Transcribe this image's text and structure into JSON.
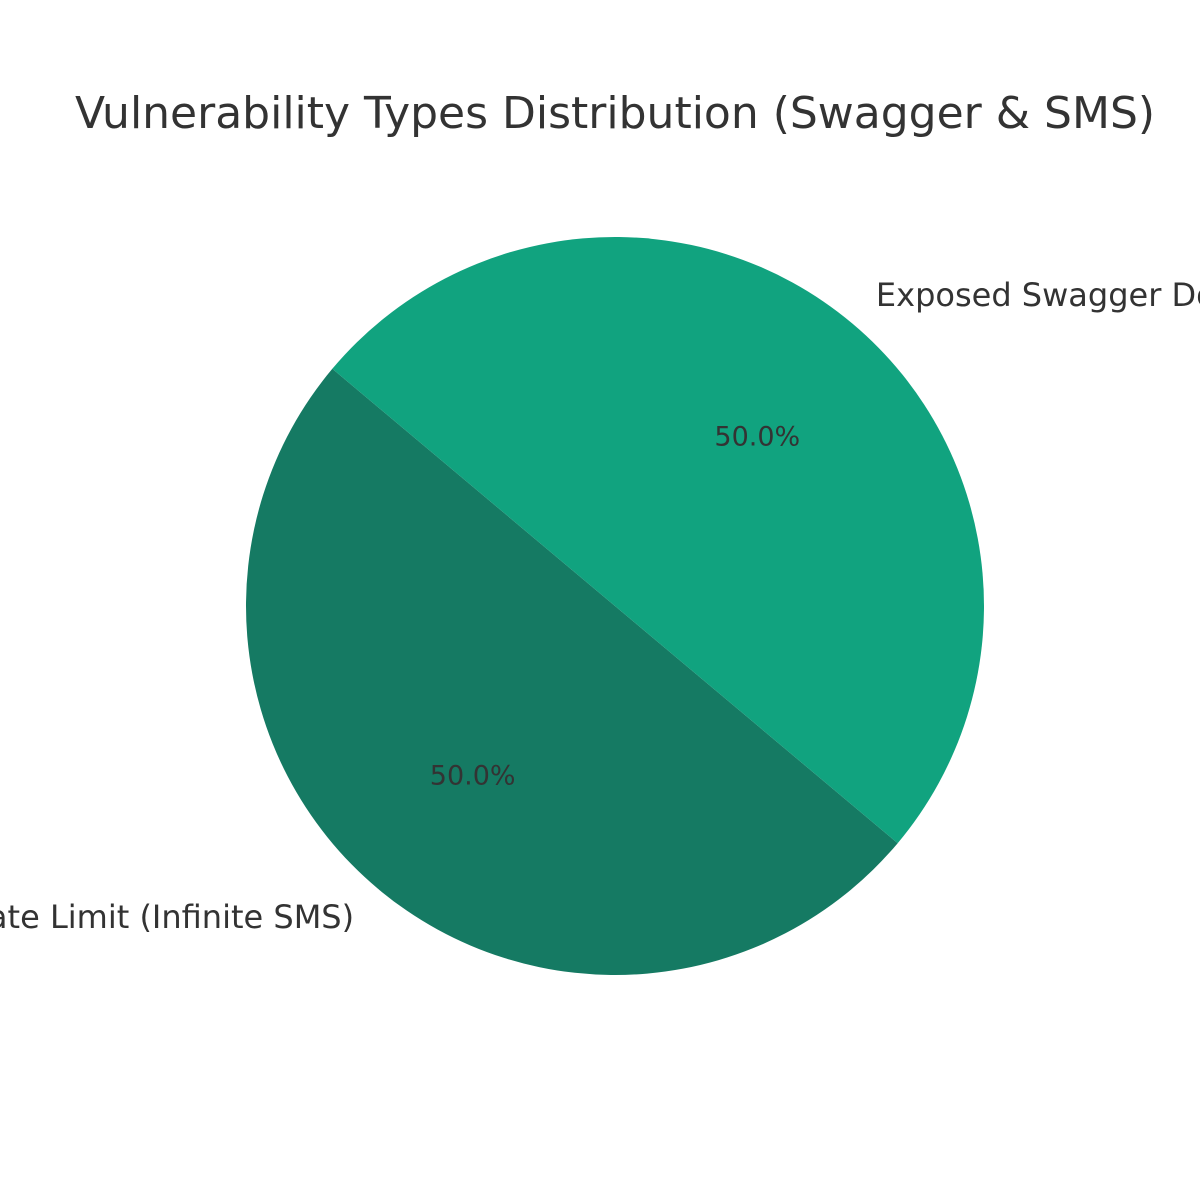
{
  "chart_data": {
    "type": "pie",
    "title": "Vulnerability Types Distribution (Swagger & SMS)",
    "slices": [
      {
        "label": "No Rate Limit (Infinite SMS)",
        "value": 50.0,
        "pct_label": "50.0%",
        "color": "#157a63"
      },
      {
        "label": "Exposed Swagger Documentation",
        "value": 50.0,
        "pct_label": "50.0%",
        "color": "#11a37f"
      }
    ],
    "start_angle_deg": 140,
    "direction": "counterclockwise",
    "label_placement": "outside",
    "pct_placement": "inside"
  }
}
